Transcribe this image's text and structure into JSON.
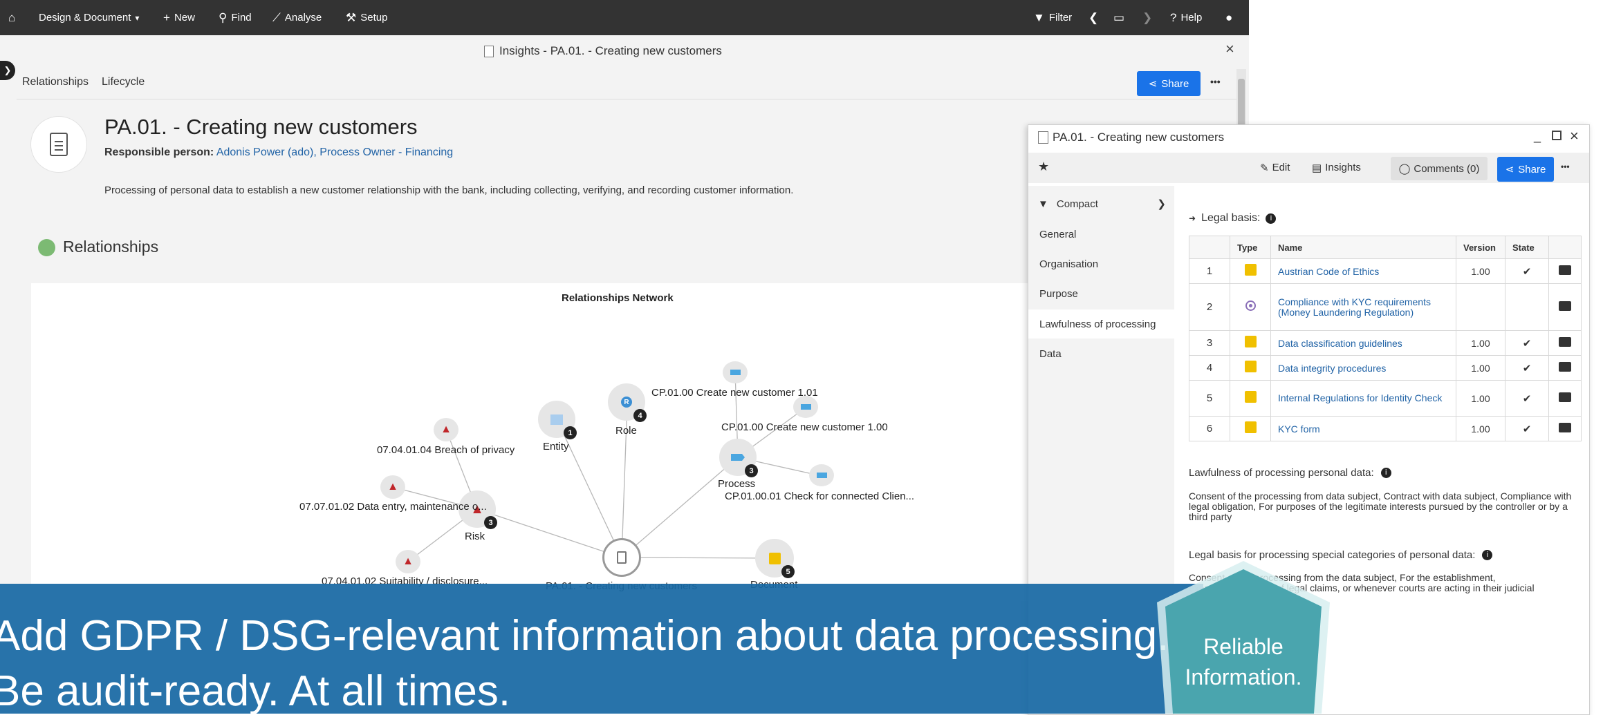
{
  "topbar": {
    "home_icon": "home-icon",
    "menu": [
      {
        "label": "Design & Document",
        "icon": "chevron-down-icon"
      },
      {
        "label": "New",
        "icon": "plus-icon"
      },
      {
        "label": "Find",
        "icon": "search-icon"
      },
      {
        "label": "Analyse",
        "icon": "chart-icon"
      },
      {
        "label": "Setup",
        "icon": "wrench-icon"
      }
    ],
    "filter_label": "Filter",
    "help_label": "Help"
  },
  "window": {
    "title": "Insights - PA.01. - Creating new customers",
    "tabs": [
      "Relationships",
      "Lifecycle"
    ],
    "share_label": "Share",
    "more_label": "•••",
    "close_label": "×"
  },
  "header": {
    "title": "PA.01. - Creating new customers",
    "responsible_label": "Responsible person:",
    "responsible_value": "Adonis Power (ado), Process Owner - Financing",
    "description": "Processing of personal data to establish a new customer relationship with the bank, including collecting, verifying, and recording customer information."
  },
  "relationships": {
    "heading": "Relationships",
    "network_title": "Relationships Network",
    "nodes": {
      "entity": {
        "label": "Entity",
        "count": "1"
      },
      "role": {
        "label": "Role",
        "count": "4"
      },
      "process": {
        "label": "Process",
        "count": "3"
      },
      "risk": {
        "label": "Risk",
        "count": "3"
      },
      "document": {
        "label": "Document",
        "count": "5"
      },
      "center": {
        "label": "PA.01. - Creating new customers"
      }
    },
    "leaves": {
      "cp1": "CP.01.00 Create new customer 1.01",
      "cp2": "CP.01.00 Create new customer 1.00",
      "cp3": "CP.01.00.01 Check for connected Clien...",
      "r1": "07.04.01.04 Breach of privacy",
      "r2": "07.07.01.02 Data entry, maintenance o...",
      "r3": "07.04.01.02 Suitability / disclosure..."
    }
  },
  "panel": {
    "title": "PA.01. - Creating new customers",
    "edit_label": "Edit",
    "insights_label": "Insights",
    "comments_label": "Comments (0)",
    "share_label": "Share",
    "more_label": "•••",
    "nav_compact": "Compact",
    "nav": [
      "General",
      "Organisation",
      "Purpose",
      "Lawfulness of processing",
      "Data"
    ],
    "legal_basis_label": "Legal basis:",
    "table": {
      "headers": [
        "",
        "Type",
        "Name",
        "Version",
        "State",
        ""
      ],
      "rows": [
        {
          "n": "1",
          "type": "sq",
          "name": "Austrian Code of Ethics",
          "version": "1.00",
          "state": "✔"
        },
        {
          "n": "2",
          "type": "ring",
          "name": "Compliance with KYC requirements (Money Laundering Regulation)",
          "version": "",
          "state": ""
        },
        {
          "n": "3",
          "type": "sq",
          "name": "Data classification guidelines",
          "version": "1.00",
          "state": "✔"
        },
        {
          "n": "4",
          "type": "sq",
          "name": "Data integrity procedures",
          "version": "1.00",
          "state": "✔"
        },
        {
          "n": "5",
          "type": "sq",
          "name": "Internal Regulations for Identity Check",
          "version": "1.00",
          "state": "✔"
        },
        {
          "n": "6",
          "type": "sq",
          "name": "KYC form",
          "version": "1.00",
          "state": "✔"
        }
      ]
    },
    "lawfulness_label": "Lawfulness of processing personal data:",
    "lawfulness_text": "Consent of the processing from data subject, Contract with data subject, Compliance with legal obligation, For purposes of the legitimate interests pursued by the controller or by a third party",
    "special_label": "Legal basis for processing special categories of personal data:",
    "special_text_1": "Consent of the processing from the data subject, For the establishment,",
    "special_text_2": "exercise or defence of legal claims, or whenever courts are acting in their judicial"
  },
  "banner": {
    "line1": "Add GDPR / DSG-relevant information about data processing.",
    "line2": "Be audit-ready. At all times.",
    "badge": "Reliable Information."
  },
  "colors": {
    "topbar": "#333333",
    "accent": "#1a73e8",
    "banner": "#1868a4",
    "hexagon": "#4aa5ae",
    "link": "#2163a6"
  }
}
